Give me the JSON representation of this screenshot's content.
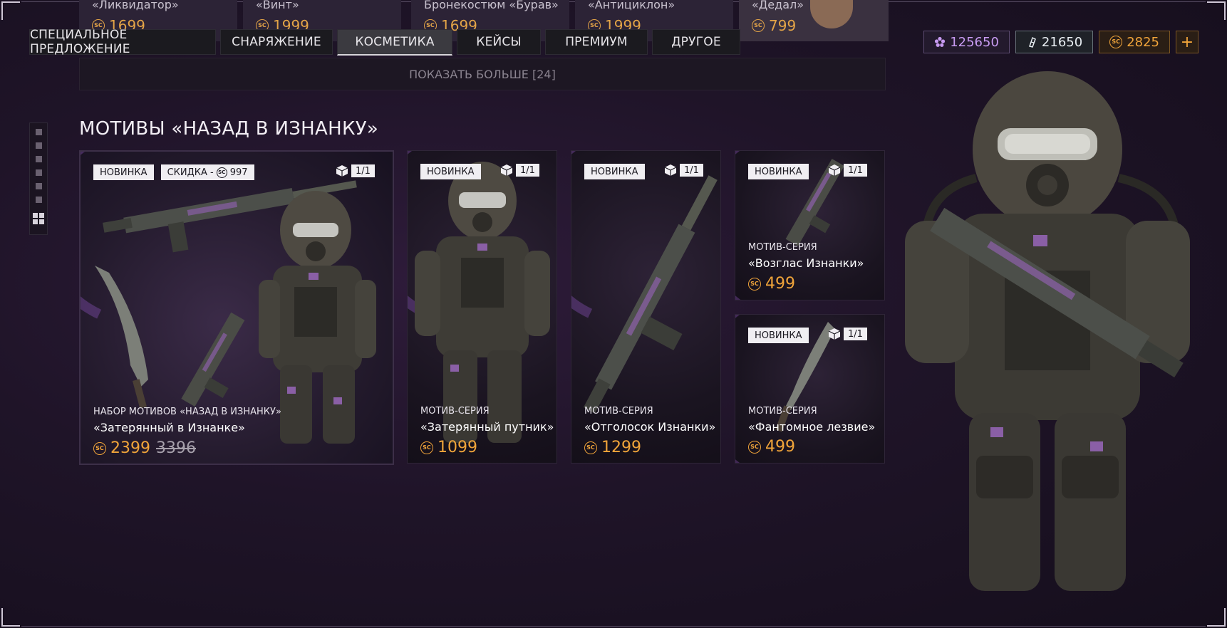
{
  "prev_row": [
    {
      "name": "«Ликвидатор»",
      "price": "1699"
    },
    {
      "name": "«Винт»",
      "price": "1999"
    },
    {
      "name": "Бронекостюм «Бурав»",
      "price": "1699"
    },
    {
      "name": "«Антициклон»",
      "price": "1999"
    },
    {
      "name": "«Дедал»",
      "price": "799"
    }
  ],
  "tabs": [
    {
      "label": "СПЕЦИАЛЬНОЕ ПРЕДЛОЖЕНИЕ",
      "active": false
    },
    {
      "label": "СНАРЯЖЕНИЕ",
      "active": false
    },
    {
      "label": "КОСМЕТИКА",
      "active": true
    },
    {
      "label": "КЕЙСЫ",
      "active": false
    },
    {
      "label": "ПРЕМИУМ",
      "active": false
    },
    {
      "label": "ДРУГОЕ",
      "active": false
    }
  ],
  "currencies": {
    "purple": "125650",
    "crystal": "21650",
    "gold": "2825",
    "add": "+"
  },
  "show_more": "ПОКАЗАТЬ БОЛЬШЕ [24]",
  "section_title": "МОТИВЫ «НАЗАД В ИЗНАНКУ»",
  "sc_symbol": "SC",
  "cards": {
    "bundle": {
      "badge_new": "НОВИНКА",
      "badge_discount": "СКИДКА -",
      "discount_value": "997",
      "limit": "1/1",
      "type": "НАБОР МОТИВОВ «НАЗАД В ИЗНАНКУ»",
      "name": "«Затерянный в Изнанке»",
      "price": "2399",
      "old_price": "3396"
    },
    "traveler": {
      "badge_new": "НОВИНКА",
      "limit": "1/1",
      "type": "МОТИВ-СЕРИЯ",
      "name": "«Затерянный путник»",
      "price": "1099"
    },
    "echo": {
      "badge_new": "НОВИНКА",
      "limit": "1/1",
      "type": "МОТИВ-СЕРИЯ",
      "name": "«Отголосок Изнанки»",
      "price": "1299"
    },
    "cry": {
      "badge_new": "НОВИНКА",
      "limit": "1/1",
      "type": "МОТИВ-СЕРИЯ",
      "name": "«Возглас Изнанки»",
      "price": "499"
    },
    "blade": {
      "badge_new": "НОВИНКА",
      "limit": "1/1",
      "type": "МОТИВ-СЕРИЯ",
      "name": "«Фантомное лезвие»",
      "price": "499"
    }
  }
}
